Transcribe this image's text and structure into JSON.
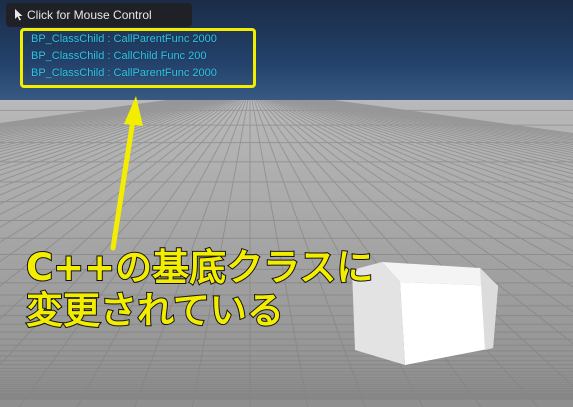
{
  "toolbar": {
    "mouse_control_label": "Click for Mouse Control"
  },
  "log_messages": [
    "BP_ClassChild : CallParentFunc 2000",
    "BP_ClassChild : CallChild Func 200",
    "BP_ClassChild : CallParentFunc 2000"
  ],
  "annotation": {
    "line1": "C++の基底クラスに",
    "line2": "変更されている"
  },
  "colors": {
    "highlight": "#f3ee00",
    "log_text": "#2fc7e6",
    "sky": "#24416a",
    "floor": "#a4a4a4"
  }
}
